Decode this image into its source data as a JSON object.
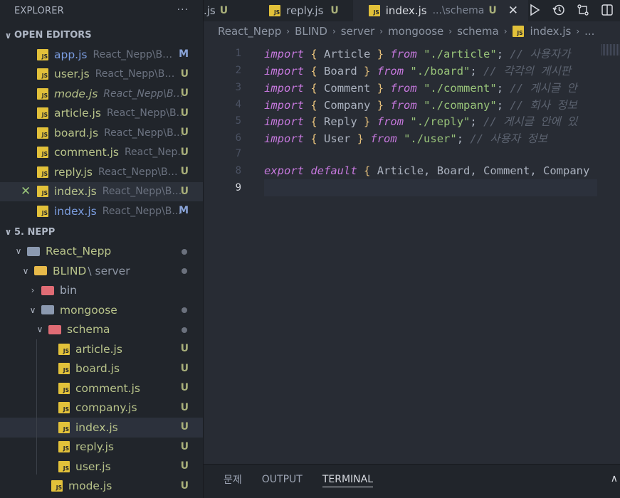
{
  "sidebar": {
    "title": "EXPLORER",
    "more": "···",
    "open_editors_label": "OPEN EDITORS",
    "open_editors": [
      {
        "name": "app.js",
        "path": "React_Nepp\\BLI...",
        "badge": "M"
      },
      {
        "name": "user.js",
        "path": "React_Nepp\\BLI...",
        "badge": "U"
      },
      {
        "name": "mode.js",
        "path": "React_Nepp\\BLI...",
        "badge": "U"
      },
      {
        "name": "article.js",
        "path": "React_Nepp\\B...",
        "badge": "U"
      },
      {
        "name": "board.js",
        "path": "React_Nepp\\B...",
        "badge": "U"
      },
      {
        "name": "comment.js",
        "path": "React_Nep...",
        "badge": "U"
      },
      {
        "name": "reply.js",
        "path": "React_Nepp\\BLI...",
        "badge": "U"
      },
      {
        "name": "index.js",
        "path": "React_Nepp\\BL...",
        "badge": "U"
      },
      {
        "name": "index.js",
        "path": "React_Nepp\\B...",
        "badge": "M"
      }
    ],
    "workspace_label": "5. NEPP",
    "tree": {
      "root": "React_Nepp",
      "blind": "BLIND",
      "blind_sub": "\\ server",
      "bin": "bin",
      "mongoose": "mongoose",
      "schema": "schema",
      "files": [
        {
          "name": "article.js",
          "badge": "U"
        },
        {
          "name": "board.js",
          "badge": "U"
        },
        {
          "name": "comment.js",
          "badge": "U"
        },
        {
          "name": "company.js",
          "badge": "U"
        },
        {
          "name": "index.js",
          "badge": "U"
        },
        {
          "name": "reply.js",
          "badge": "U"
        },
        {
          "name": "user.js",
          "badge": "U"
        }
      ],
      "mode": {
        "name": "mode.js",
        "badge": "U"
      }
    }
  },
  "tabs": [
    {
      "label": ".js",
      "badge": "U"
    },
    {
      "label": "reply.js",
      "badge": "U"
    },
    {
      "label": "index.js",
      "sub": "...\\schema",
      "badge": "U",
      "close": "✕"
    }
  ],
  "breadcrumb": [
    "React_Nepp",
    "BLIND",
    "server",
    "mongoose",
    "schema",
    "index.js",
    "..."
  ],
  "code": [
    {
      "n": "1",
      "model": "Article",
      "path": "\"./article\"",
      "comment": "// 사용자가"
    },
    {
      "n": "2",
      "model": "Board",
      "path": "\"./board\"",
      "comment": "// 각각의 게시판"
    },
    {
      "n": "3",
      "model": "Comment",
      "path": "\"./comment\"",
      "comment": "// 게시글 안"
    },
    {
      "n": "4",
      "model": "Company",
      "path": "\"./company\"",
      "comment": "// 회사 정보"
    },
    {
      "n": "5",
      "model": "Reply",
      "path": "\"./reply\"",
      "comment": "// 게시글 안에 있"
    },
    {
      "n": "6",
      "model": "User",
      "path": "\"./user\"",
      "comment": "// 사용자 정보"
    }
  ],
  "line7": "7",
  "line8": {
    "n": "8",
    "export": "export",
    "default": "default",
    "body": "Article, Board, Comment, Company"
  },
  "line9": "9",
  "kw": {
    "import": "import",
    "from": "from",
    "lbrace": "{",
    "rbrace": "}",
    "semi": ";"
  },
  "panel": {
    "tabs": [
      "문제",
      "OUTPUT",
      "TERMINAL"
    ]
  }
}
